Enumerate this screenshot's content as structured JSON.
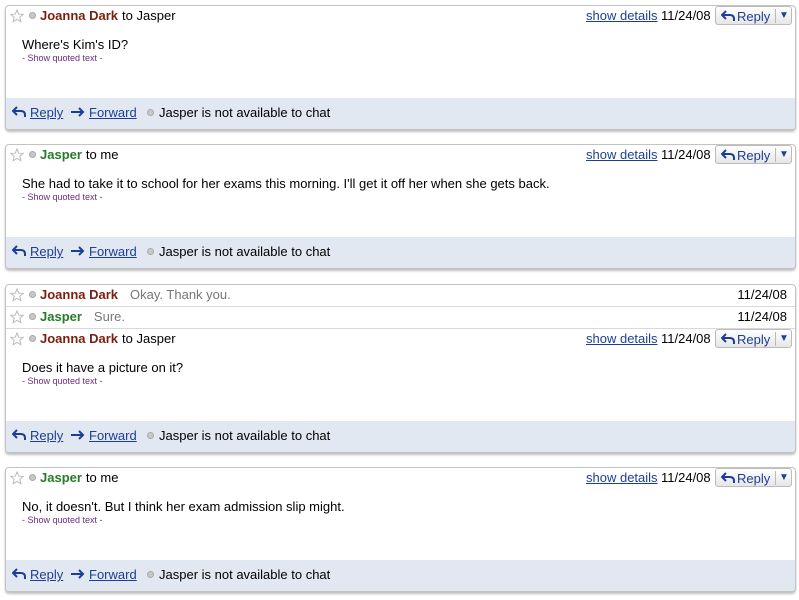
{
  "messages": [
    {
      "sender": "Joanna Dark",
      "recipient": "to Jasper",
      "show_details": "show details",
      "date": "11/24/08",
      "reply_label": "Reply",
      "body": "Where's Kim's ID?",
      "quoted": "- Show quoted text -",
      "footer": {
        "reply": "Reply",
        "forward": "Forward",
        "chat_status": "Jasper is not available to chat"
      }
    },
    {
      "sender": "Jasper",
      "recipient": "to me",
      "show_details": "show details",
      "date": "11/24/08",
      "reply_label": "Reply",
      "body": "She had to take it to school for her exams this morning. I'll get it off her when she gets back.",
      "quoted": "- Show quoted text -",
      "footer": {
        "reply": "Reply",
        "forward": "Forward",
        "chat_status": "Jasper is not available to chat"
      }
    },
    {
      "sender": "Joanna Dark",
      "recipient": "to Jasper",
      "show_details": "show details",
      "date": "11/24/08",
      "reply_label": "Reply",
      "body": "Does it have a picture on it?",
      "quoted": "- Show quoted text -",
      "footer": {
        "reply": "Reply",
        "forward": "Forward",
        "chat_status": "Jasper is not available to chat"
      }
    },
    {
      "sender": "Jasper",
      "recipient": "to me",
      "show_details": "show details",
      "date": "11/24/08",
      "reply_label": "Reply",
      "body": "No, it doesn't. But I think her exam admission slip might.",
      "quoted": "- Show quoted text -",
      "footer": {
        "reply": "Reply",
        "forward": "Forward",
        "chat_status": "Jasper is not available to chat"
      }
    }
  ],
  "collapsed": [
    {
      "sender": "Joanna Dark",
      "snippet": "Okay. Thank you.",
      "date": "11/24/08"
    },
    {
      "sender": "Jasper",
      "snippet": "Sure.",
      "date": "11/24/08"
    }
  ],
  "colors": {
    "joanna": "#7b1e10",
    "jasper": "#297a29",
    "link": "#1c3f95",
    "footer_bg": "#e2e8f1"
  },
  "icons": {
    "star": "star-icon",
    "presence": "presence-dot-icon",
    "reply": "reply-arrow-icon",
    "forward": "forward-arrow-icon",
    "dropdown": "chevron-down-icon"
  }
}
